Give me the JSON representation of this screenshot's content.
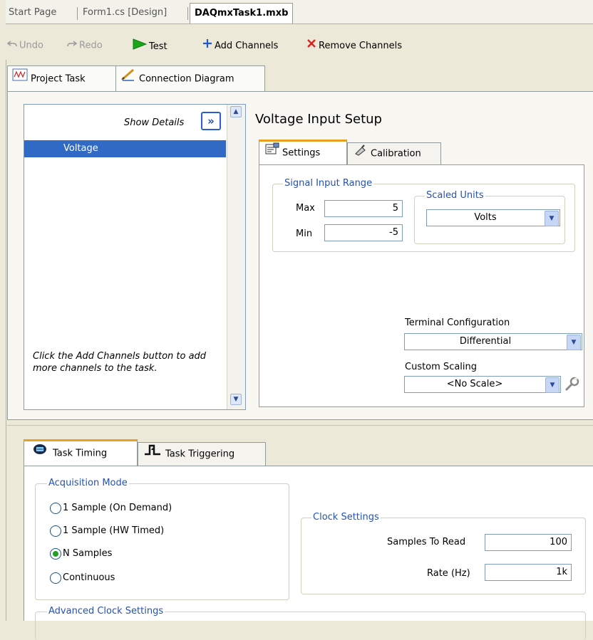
{
  "doc_tabs": [
    "Start Page",
    "Form1.cs [Design]",
    "DAQmxTask1.mxb"
  ],
  "toolbar": {
    "undo": "Undo",
    "redo": "Redo",
    "test": "Test",
    "add_channels": "Add Channels",
    "remove_channels": "Remove Channels"
  },
  "panel_tabs": [
    "Project Task",
    "Connection Diagram"
  ],
  "channels": {
    "show_details": "Show Details",
    "items": [
      "Voltage"
    ],
    "hint": "Click the Add Channels button to add more channels to the task."
  },
  "setup": {
    "title": "Voltage Input Setup",
    "tabs": [
      "Settings",
      "Calibration"
    ],
    "signal_input_range": {
      "legend": "Signal Input Range",
      "max_label": "Max",
      "max_value": "5",
      "min_label": "Min",
      "min_value": "-5"
    },
    "scaled_units": {
      "legend": "Scaled Units",
      "value": "Volts"
    },
    "terminal_configuration": {
      "label": "Terminal Configuration",
      "value": "Differential"
    },
    "custom_scaling": {
      "label": "Custom Scaling",
      "value": "<No Scale>"
    }
  },
  "timing": {
    "tabs": [
      "Task Timing",
      "Task Triggering"
    ],
    "acquisition_mode": {
      "legend": "Acquisition Mode",
      "options": [
        "1 Sample (On Demand)",
        "1 Sample (HW Timed)",
        "N Samples",
        "Continuous"
      ],
      "selected": "N Samples"
    },
    "clock_settings": {
      "legend": "Clock Settings",
      "samples_to_read_label": "Samples To Read",
      "samples_to_read": "100",
      "rate_label": "Rate (Hz)",
      "rate": "1k"
    },
    "advanced_clock_settings": "Advanced Clock Settings"
  },
  "colors": {
    "selection": "#316ac5",
    "legend_text": "#2351b4",
    "remove_x": "#e02020",
    "test_arrow": "#1aa61a"
  }
}
